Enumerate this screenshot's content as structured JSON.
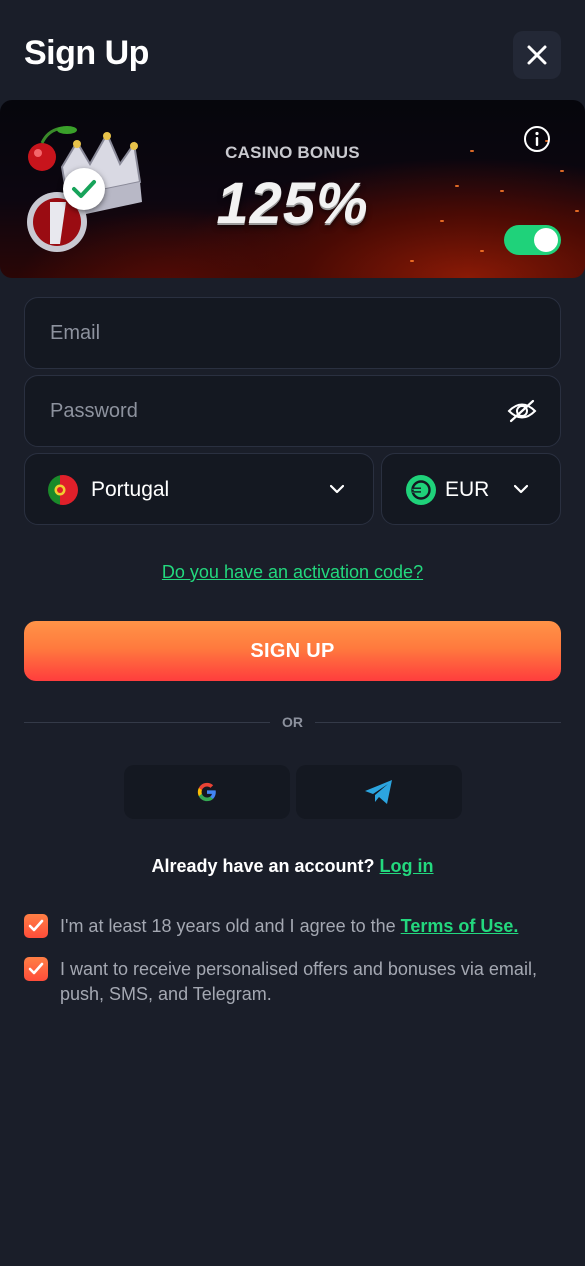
{
  "header": {
    "title": "Sign Up"
  },
  "banner": {
    "label": "CASINO BONUS",
    "value": "125%",
    "bonus_enabled": true
  },
  "form": {
    "email_placeholder": "Email",
    "password_placeholder": "Password",
    "country": "Portugal",
    "currency": "EUR"
  },
  "links": {
    "activation_code": "Do you have an activation code?"
  },
  "actions": {
    "signup_label": "SIGN UP",
    "or_label": "OR"
  },
  "account": {
    "prompt": "Already have an account?",
    "login_label": "Log in"
  },
  "consents": [
    {
      "text": "I'm at least 18 years old and I agree to the",
      "link": "Terms of Use.",
      "checked": true
    },
    {
      "text": "I want to receive personalised offers and bonuses via email, push, SMS, and Telegram.",
      "checked": true
    }
  ],
  "colors": {
    "accent": "#23d87e",
    "background": "#1a1e29",
    "button_top": "#ff9347",
    "button_bottom": "#ff3d3d"
  }
}
